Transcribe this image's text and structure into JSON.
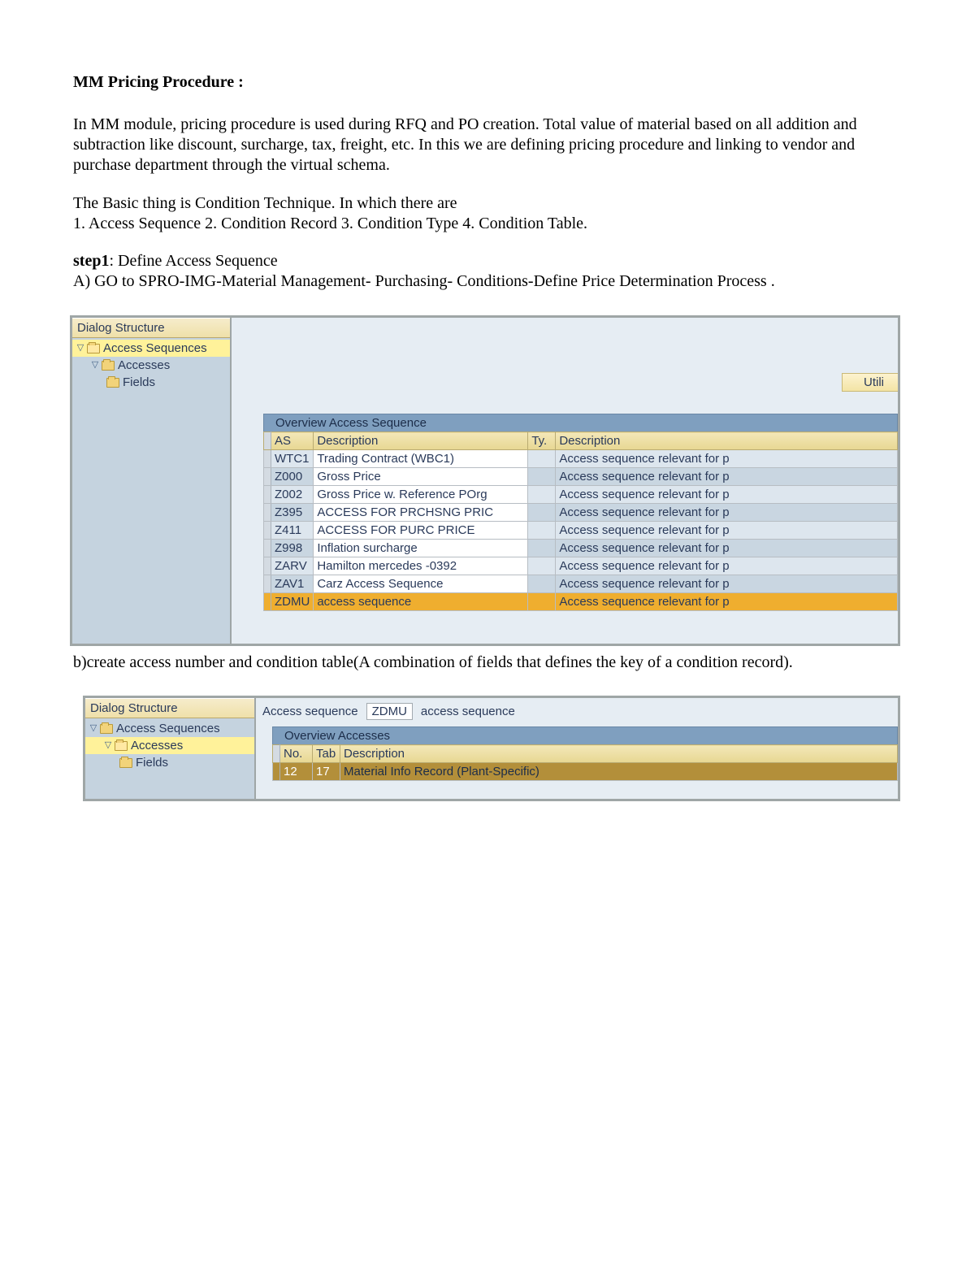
{
  "title": "MM Pricing Procedure :",
  "para1": "In MM module, pricing procedure is used during RFQ and PO creation. Total value of material based on all addition and subtraction like discount, surcharge, tax, freight, etc. In this we are defining pricing procedure and linking to vendor and purchase department through the virtual schema.",
  "para2a": " The Basic thing is Condition Technique. In which there are",
  "para2b": "1. Access Sequence 2. Condition Record 3. Condition Type 4. Condition Table.",
  "step1_label": "step1",
  "step1_text": ":  Define Access Sequence",
  "step1_sub": "  A) GO to  SPRO-IMG-Material Management- Purchasing- Conditions-Define Price Determination Process .",
  "mid_text": "b)create access number and condition table(A combination of fields that defines the key of a condition record).",
  "sap1": {
    "tree_header": "Dialog Structure",
    "tree": {
      "n1": "Access Sequences",
      "n2": "Accesses",
      "n3": "Fields"
    },
    "util": "Utili",
    "overview": "Overview Access Sequence",
    "cols": {
      "c1": "AS",
      "c2": "Description",
      "c3": "Ty.",
      "c4": "Description"
    },
    "rows": [
      {
        "as": "WTC1",
        "d1": "Trading Contract (WBC1)",
        "ty": "",
        "d2": "Access sequence relevant for p"
      },
      {
        "as": "Z000",
        "d1": "Gross Price",
        "ty": "",
        "d2": "Access sequence relevant for p"
      },
      {
        "as": "Z002",
        "d1": "Gross Price w. Reference POrg",
        "ty": "",
        "d2": "Access sequence relevant for p"
      },
      {
        "as": "Z395",
        "d1": "ACCESS FOR PRCHSNG PRIC",
        "ty": "",
        "d2": "Access sequence relevant for p"
      },
      {
        "as": "Z411",
        "d1": "ACCESS FOR PURC PRICE",
        "ty": "",
        "d2": "Access sequence relevant for p"
      },
      {
        "as": "Z998",
        "d1": "Inflation surcharge",
        "ty": "",
        "d2": "Access sequence relevant for p"
      },
      {
        "as": "ZARV",
        "d1": "Hamilton mercedes -0392",
        "ty": "",
        "d2": "Access sequence relevant for p"
      },
      {
        "as": "ZAV1",
        "d1": "Carz Access Sequence",
        "ty": "",
        "d2": "Access sequence relevant for p"
      },
      {
        "as": "ZDMU",
        "d1": "access sequence",
        "ty": "",
        "d2": "Access sequence relevant for p"
      }
    ]
  },
  "sap2": {
    "tree_header": "Dialog Structure",
    "tree": {
      "n1": "Access Sequences",
      "n2": "Accesses",
      "n3": "Fields"
    },
    "lbl": "Access sequence",
    "val": "ZDMU",
    "val2": "access sequence",
    "overview": "Overview Accesses",
    "cols": {
      "c1": "No.",
      "c2": "Tab",
      "c3": "Description"
    },
    "row": {
      "no": "12",
      "tab": "17",
      "desc": "Material Info Record (Plant-Specific)"
    }
  }
}
